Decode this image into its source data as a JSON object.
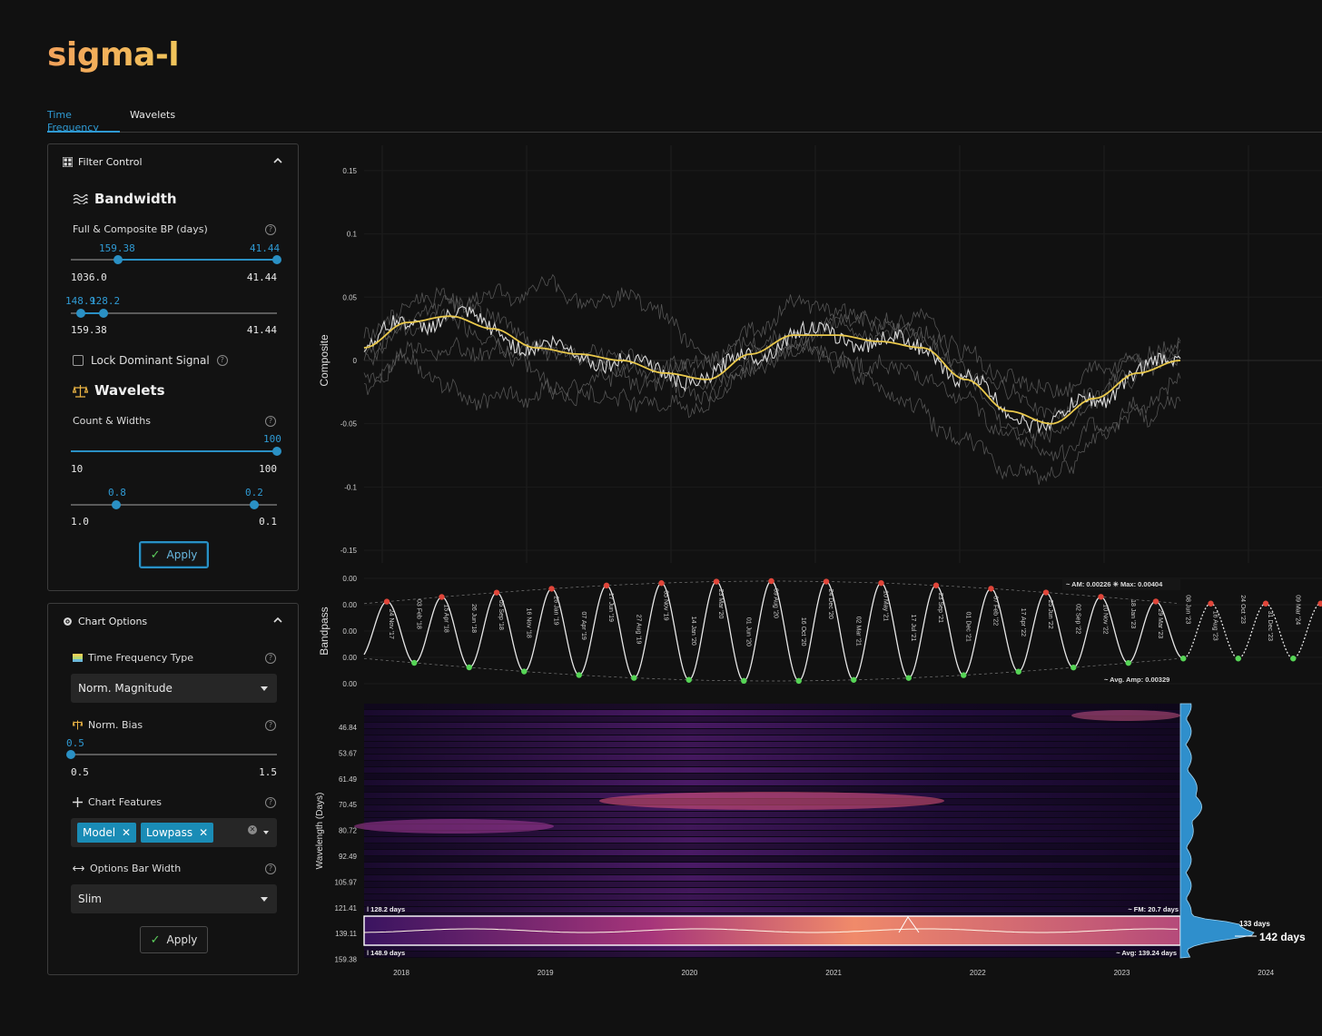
{
  "app": {
    "logo": "sigma-l"
  },
  "tabs": [
    {
      "label": "Time Frequency",
      "active": true
    },
    {
      "label": "Wavelets",
      "active": false
    }
  ],
  "filter_control": {
    "title": "Filter Control",
    "bandwidth": {
      "title": "Bandwidth",
      "label": "Full & Composite BP (days)",
      "slider1": {
        "min_label": "1036.0",
        "max_label": "41.44",
        "low_value": "159.38",
        "high_value": "41.44",
        "low_frac": 0.23,
        "high_frac": 1.0
      },
      "slider2": {
        "min_label": "159.38",
        "max_label": "41.44",
        "low_value": "148.9",
        "high_value": "128.2",
        "low_frac": 0.05,
        "high_frac": 0.16
      },
      "lock_label": "Lock Dominant Signal"
    },
    "wavelets": {
      "title": "Wavelets",
      "label": "Count & Widths",
      "slider1": {
        "min_label": "10",
        "max_label": "100",
        "value": "100",
        "frac": 1.0
      },
      "slider2": {
        "min_label": "1.0",
        "max_label": "0.1",
        "low_value": "0.8",
        "high_value": "0.2",
        "low_frac": 0.22,
        "high_frac": 0.89
      }
    },
    "apply_label": "Apply"
  },
  "chart_options": {
    "title": "Chart Options",
    "tf_type": {
      "label": "Time Frequency Type",
      "value": "Norm. Magnitude"
    },
    "norm_bias": {
      "label": "Norm. Bias",
      "value": "0.5",
      "min_label": "0.5",
      "max_label": "1.5",
      "frac": 0.0
    },
    "features": {
      "label": "Chart Features",
      "tags": [
        "Model",
        "Lowpass"
      ]
    },
    "bar_width": {
      "label": "Options Bar Width",
      "value": "Slim"
    },
    "apply_label": "Apply"
  },
  "chart_data": [
    {
      "type": "line",
      "ylabel": "Composite",
      "yticks": [
        "0.15",
        "0.1",
        "0.05",
        "0",
        "-0.05",
        "-0.1",
        "-0.15"
      ],
      "ytick_values": [
        0.15,
        0.1,
        0.05,
        0,
        -0.05,
        -0.1,
        -0.15
      ],
      "ylim": [
        -0.16,
        0.17
      ],
      "series": [
        {
          "color": "#e9c84b",
          "values": [
            0.01,
            0.03,
            0.035,
            0.025,
            0.01,
            0.005,
            0.0,
            -0.01,
            -0.015,
            0.005,
            0.02,
            0.02,
            0.015,
            0.01,
            -0.015,
            -0.04,
            -0.05,
            -0.03,
            -0.01,
            0.0
          ]
        }
      ]
    },
    {
      "type": "line",
      "ylabel": "Bandpass",
      "yticks": [
        "0.00",
        "0.00",
        "0.00",
        "0.00",
        "0.00"
      ],
      "peak_labels": [
        "24 Nov '17",
        "15 Apr '18",
        "05 Sep '18",
        "26 Jan '19",
        "17 Jun '19",
        "05 Nov '19",
        "23 Mar '20",
        "09 Aug '20",
        "24 Dec '20",
        "10 May '21",
        "23 Sep '21",
        "07 Feb '22",
        "25 Jun '22",
        "10 Nov '22",
        "29 Mar '23",
        "16 Aug '23",
        "31 Dec '23",
        "16 May '24"
      ],
      "trough_labels": [
        "03 Feb '18",
        "26 Jun '18",
        "16 Nov '18",
        "07 Apr '19",
        "27 Aug '19",
        "14 Jan '20",
        "01 Jun '20",
        "16 Oct '20",
        "02 Mar '21",
        "17 Jul '21",
        "01 Dec '21",
        "17 Apr '22",
        "02 Sep '22",
        "18 Jan '23",
        "08 Jun '23",
        "24 Oct '23",
        "09 Mar '24"
      ],
      "annotations": {
        "am": "AM: 0.00226",
        "max": "Max: 0.00404",
        "avg_amp": "Avg. Amp: 0.00329"
      }
    },
    {
      "type": "heatmap",
      "ylabel": "Wavelength (Days)",
      "yticks": [
        "46.84",
        "53.67",
        "61.49",
        "70.45",
        "80.72",
        "92.49",
        "105.97",
        "121.41",
        "139.11",
        "159.38"
      ],
      "xticks": [
        "2018",
        "2019",
        "2020",
        "2021",
        "2022",
        "2023",
        "2024"
      ],
      "band_labels": {
        "upper": "128.2 days",
        "lower": "148.9 days",
        "fm": "FM: 20.7 days",
        "avg": "Avg: 139.24 days"
      },
      "spectrum_labels": {
        "secondary": "133 days",
        "primary": "142 days"
      }
    }
  ]
}
